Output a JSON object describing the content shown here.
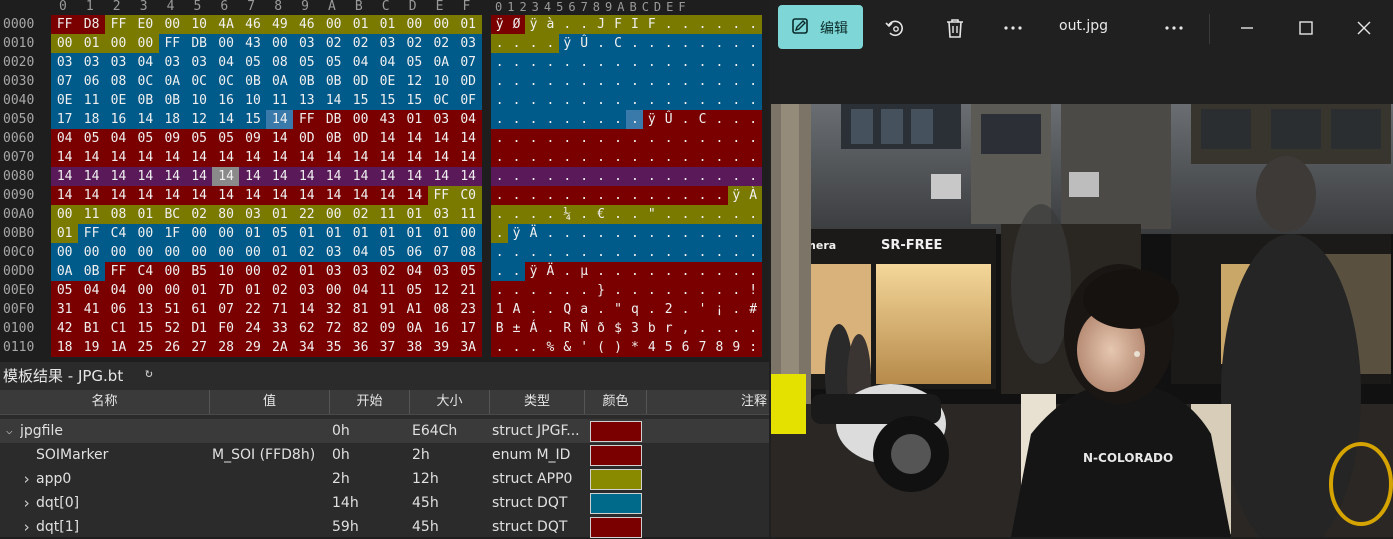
{
  "hex": {
    "col_headers": [
      "0",
      "1",
      "2",
      "3",
      "4",
      "5",
      "6",
      "7",
      "8",
      "9",
      "A",
      "B",
      "C",
      "D",
      "E",
      "F"
    ],
    "ascii_col_header": "0123456789ABCDEF",
    "rows": [
      {
        "offset": "0000",
        "bytes": [
          "FF",
          "D8",
          "FF",
          "E0",
          "00",
          "10",
          "4A",
          "46",
          "49",
          "46",
          "00",
          "01",
          "01",
          "00",
          "00",
          "01"
        ],
        "ascii": [
          "ÿ",
          "Ø",
          "ÿ",
          "à",
          ".",
          ".",
          "J",
          "F",
          "I",
          "F",
          ".",
          ".",
          ".",
          ".",
          ".",
          "."
        ]
      },
      {
        "offset": "0010",
        "bytes": [
          "00",
          "01",
          "00",
          "00",
          "FF",
          "DB",
          "00",
          "43",
          "00",
          "03",
          "02",
          "02",
          "03",
          "02",
          "02",
          "03"
        ],
        "ascii": [
          ".",
          ".",
          ".",
          ".",
          "ÿ",
          "Û",
          ".",
          "C",
          ".",
          ".",
          ".",
          ".",
          ".",
          ".",
          ".",
          "."
        ]
      },
      {
        "offset": "0020",
        "bytes": [
          "03",
          "03",
          "03",
          "04",
          "03",
          "03",
          "04",
          "05",
          "08",
          "05",
          "05",
          "04",
          "04",
          "05",
          "0A",
          "07"
        ],
        "ascii": [
          ".",
          ".",
          ".",
          ".",
          ".",
          ".",
          ".",
          ".",
          ".",
          ".",
          ".",
          ".",
          ".",
          ".",
          ".",
          "."
        ]
      },
      {
        "offset": "0030",
        "bytes": [
          "07",
          "06",
          "08",
          "0C",
          "0A",
          "0C",
          "0C",
          "0B",
          "0A",
          "0B",
          "0B",
          "0D",
          "0E",
          "12",
          "10",
          "0D"
        ],
        "ascii": [
          ".",
          ".",
          ".",
          ".",
          ".",
          ".",
          ".",
          ".",
          ".",
          ".",
          ".",
          ".",
          ".",
          ".",
          ".",
          "."
        ]
      },
      {
        "offset": "0040",
        "bytes": [
          "0E",
          "11",
          "0E",
          "0B",
          "0B",
          "10",
          "16",
          "10",
          "11",
          "13",
          "14",
          "15",
          "15",
          "15",
          "0C",
          "0F"
        ],
        "ascii": [
          ".",
          ".",
          ".",
          ".",
          ".",
          ".",
          ".",
          ".",
          ".",
          ".",
          ".",
          ".",
          ".",
          ".",
          ".",
          "."
        ]
      },
      {
        "offset": "0050",
        "bytes": [
          "17",
          "18",
          "16",
          "14",
          "18",
          "12",
          "14",
          "15",
          "14",
          "FF",
          "DB",
          "00",
          "43",
          "01",
          "03",
          "04"
        ],
        "ascii": [
          ".",
          ".",
          ".",
          ".",
          ".",
          ".",
          ".",
          ".",
          ".",
          "ÿ",
          "Û",
          ".",
          "C",
          ".",
          ".",
          "."
        ]
      },
      {
        "offset": "0060",
        "bytes": [
          "04",
          "05",
          "04",
          "05",
          "09",
          "05",
          "05",
          "09",
          "14",
          "0D",
          "0B",
          "0D",
          "14",
          "14",
          "14",
          "14"
        ],
        "ascii": [
          ".",
          ".",
          ".",
          ".",
          ".",
          ".",
          ".",
          ".",
          ".",
          ".",
          ".",
          ".",
          ".",
          ".",
          ".",
          "."
        ]
      },
      {
        "offset": "0070",
        "bytes": [
          "14",
          "14",
          "14",
          "14",
          "14",
          "14",
          "14",
          "14",
          "14",
          "14",
          "14",
          "14",
          "14",
          "14",
          "14",
          "14"
        ],
        "ascii": [
          ".",
          ".",
          ".",
          ".",
          ".",
          ".",
          ".",
          ".",
          ".",
          ".",
          ".",
          ".",
          ".",
          ".",
          ".",
          "."
        ]
      },
      {
        "offset": "0080",
        "bytes": [
          "14",
          "14",
          "14",
          "14",
          "14",
          "14",
          "14",
          "14",
          "14",
          "14",
          "14",
          "14",
          "14",
          "14",
          "14",
          "14"
        ],
        "ascii": [
          ".",
          ".",
          ".",
          ".",
          ".",
          ".",
          ".",
          ".",
          ".",
          ".",
          ".",
          ".",
          ".",
          ".",
          ".",
          "."
        ]
      },
      {
        "offset": "0090",
        "bytes": [
          "14",
          "14",
          "14",
          "14",
          "14",
          "14",
          "14",
          "14",
          "14",
          "14",
          "14",
          "14",
          "14",
          "14",
          "FF",
          "C0"
        ],
        "ascii": [
          ".",
          ".",
          ".",
          ".",
          ".",
          ".",
          ".",
          ".",
          ".",
          ".",
          ".",
          ".",
          ".",
          ".",
          "ÿ",
          "À"
        ]
      },
      {
        "offset": "00A0",
        "bytes": [
          "00",
          "11",
          "08",
          "01",
          "BC",
          "02",
          "80",
          "03",
          "01",
          "22",
          "00",
          "02",
          "11",
          "01",
          "03",
          "11"
        ],
        "ascii": [
          ".",
          ".",
          ".",
          ".",
          "¼",
          ".",
          "€",
          ".",
          ".",
          "\"",
          ".",
          ".",
          ".",
          ".",
          ".",
          "."
        ]
      },
      {
        "offset": "00B0",
        "bytes": [
          "01",
          "FF",
          "C4",
          "00",
          "1F",
          "00",
          "00",
          "01",
          "05",
          "01",
          "01",
          "01",
          "01",
          "01",
          "01",
          "00"
        ],
        "ascii": [
          ".",
          "ÿ",
          "Ä",
          ".",
          ".",
          ".",
          ".",
          ".",
          ".",
          ".",
          ".",
          ".",
          ".",
          ".",
          ".",
          "."
        ]
      },
      {
        "offset": "00C0",
        "bytes": [
          "00",
          "00",
          "00",
          "00",
          "00",
          "00",
          "00",
          "00",
          "01",
          "02",
          "03",
          "04",
          "05",
          "06",
          "07",
          "08",
          "09"
        ],
        "ascii": [
          ".",
          ".",
          ".",
          ".",
          ".",
          ".",
          ".",
          ".",
          ".",
          ".",
          ".",
          ".",
          ".",
          ".",
          ".",
          "."
        ]
      },
      {
        "offset": "00D0",
        "bytes": [
          "0A",
          "0B",
          "FF",
          "C4",
          "00",
          "B5",
          "10",
          "00",
          "02",
          "01",
          "03",
          "03",
          "02",
          "04",
          "03",
          "05"
        ],
        "ascii": [
          ".",
          ".",
          "ÿ",
          "Ä",
          ".",
          "µ",
          ".",
          ".",
          ".",
          ".",
          ".",
          ".",
          ".",
          ".",
          ".",
          "."
        ]
      },
      {
        "offset": "00E0",
        "bytes": [
          "05",
          "04",
          "04",
          "00",
          "00",
          "01",
          "7D",
          "01",
          "02",
          "03",
          "00",
          "04",
          "11",
          "05",
          "12",
          "21"
        ],
        "ascii": [
          ".",
          ".",
          ".",
          ".",
          ".",
          ".",
          "}",
          ".",
          ".",
          ".",
          ".",
          ".",
          ".",
          ".",
          ".",
          "!"
        ]
      },
      {
        "offset": "00F0",
        "bytes": [
          "31",
          "41",
          "06",
          "13",
          "51",
          "61",
          "07",
          "22",
          "71",
          "14",
          "32",
          "81",
          "91",
          "A1",
          "08",
          "23"
        ],
        "ascii": [
          "1",
          "A",
          ".",
          ".",
          "Q",
          "a",
          ".",
          "\"",
          "q",
          ".",
          "2",
          ".",
          "'",
          "¡",
          ".",
          "#"
        ]
      },
      {
        "offset": "0100",
        "bytes": [
          "42",
          "B1",
          "C1",
          "15",
          "52",
          "D1",
          "F0",
          "24",
          "33",
          "62",
          "72",
          "82",
          "09",
          "0A",
          "16",
          "17"
        ],
        "ascii": [
          "B",
          "±",
          "Á",
          ".",
          "R",
          "Ñ",
          "ð",
          "$",
          "3",
          "b",
          "r",
          ",",
          ".",
          ".",
          ".",
          "."
        ]
      },
      {
        "offset": "0110",
        "bytes": [
          "18",
          "19",
          "1A",
          "25",
          "26",
          "27",
          "28",
          "29",
          "2A",
          "34",
          "35",
          "36",
          "37",
          "38",
          "39",
          "3A"
        ],
        "ascii": [
          ".",
          ".",
          ".",
          "%",
          "&",
          "'",
          "(",
          ")",
          "*",
          "4",
          "5",
          "6",
          "7",
          "8",
          "9",
          ":"
        ]
      }
    ]
  },
  "template_panel": {
    "title": "模板结果 - JPG.bt",
    "refresh_icon": "refresh-icon",
    "columns": [
      "名称",
      "值",
      "开始",
      "大小",
      "类型",
      "颜色",
      "注释"
    ],
    "rows": [
      {
        "name": "jpgfile",
        "value": "",
        "start": "0h",
        "size": "E64Ch",
        "type": "struct JPGF...",
        "color": "#7a0000",
        "expand": "open"
      },
      {
        "name": "SOIMarker",
        "value": "M_SOI (FFD8h)",
        "start": "0h",
        "size": "2h",
        "type": "enum M_ID",
        "color": "#7a0000",
        "expand": "none"
      },
      {
        "name": "app0",
        "value": "",
        "start": "2h",
        "size": "12h",
        "type": "struct APP0",
        "color": "#8a8a00",
        "expand": "closed"
      },
      {
        "name": "dqt[0]",
        "value": "",
        "start": "14h",
        "size": "45h",
        "type": "struct DQT",
        "color": "#006a8a",
        "expand": "closed"
      },
      {
        "name": "dqt[1]",
        "value": "",
        "start": "59h",
        "size": "45h",
        "type": "struct DQT",
        "color": "#7a0000",
        "expand": "closed"
      }
    ]
  },
  "viewer": {
    "edit_label": "编辑",
    "filename": "out.jpg",
    "toolbar_icons": [
      "edit-icon",
      "rotate-icon",
      "delete-icon",
      "more-icon",
      "more-icon",
      "minimize-icon",
      "maximize-icon",
      "close-icon"
    ],
    "photo_signs": {
      "shop_sign": "SR-FREE",
      "left_sign": "amera",
      "hoodie_text": "N-COLORADO"
    }
  },
  "colors": {
    "red": "#7a0000",
    "olive": "#7a7a00",
    "blue": "#005a8a",
    "purple": "#5a1a5a",
    "edit_button": "#7fd6d6"
  }
}
